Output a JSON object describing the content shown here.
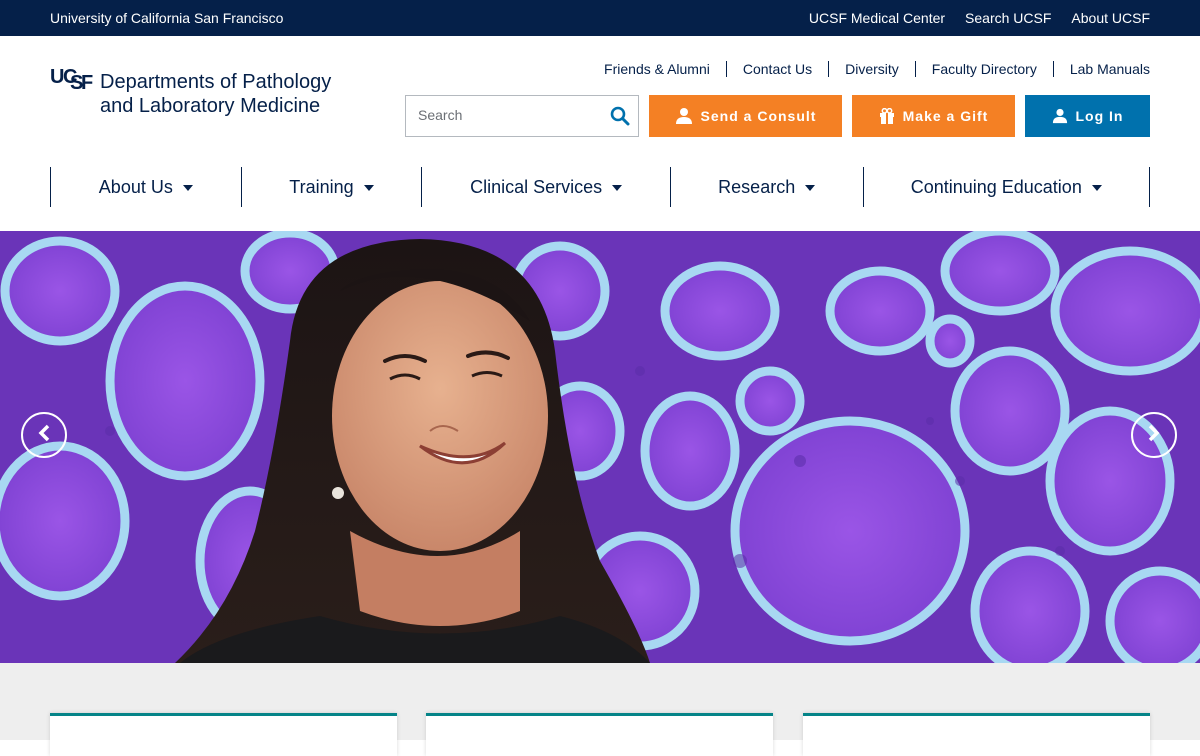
{
  "topbar": {
    "university": "University of California San Francisco",
    "links": [
      "UCSF Medical Center",
      "Search UCSF",
      "About UCSF"
    ]
  },
  "logo": {
    "mark": [
      "U",
      "C",
      "S",
      "F"
    ],
    "line1": "Departments of Pathology",
    "line2": "and Laboratory Medicine"
  },
  "utility_links": [
    "Friends & Alumni",
    "Contact Us",
    "Diversity",
    "Faculty Directory",
    "Lab Manuals"
  ],
  "search": {
    "placeholder": "Search",
    "icon": "search-icon"
  },
  "buttons": {
    "consult": "Send a Consult",
    "gift": "Make a Gift",
    "login": "Log In"
  },
  "nav": [
    "About Us",
    "Training",
    "Clinical Services",
    "Research",
    "Continuing Education"
  ],
  "colors": {
    "navy": "#052049",
    "orange": "#f48024",
    "blue": "#0071ad",
    "teal": "#058488",
    "hero_purple": "#7a3ec9"
  },
  "hero": {
    "prev_icon": "chevron-left-icon",
    "next_icon": "chevron-right-icon"
  }
}
